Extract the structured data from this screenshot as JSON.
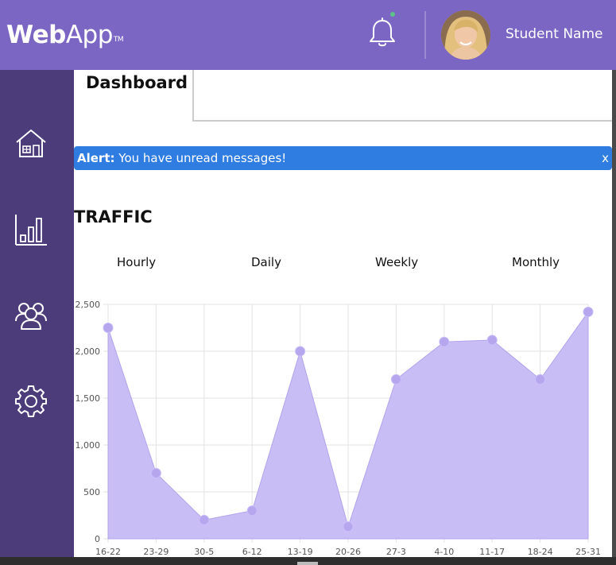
{
  "header": {
    "logo_bold": "Web",
    "logo_light": "App",
    "logo_tm": "TM",
    "user_name": "Student Name",
    "notification_dot_color": "#5dc38a"
  },
  "sidebar": {
    "items": [
      {
        "icon": "home-icon"
      },
      {
        "icon": "bar-chart-icon"
      },
      {
        "icon": "users-icon"
      },
      {
        "icon": "gear-icon"
      }
    ]
  },
  "main": {
    "page_title": "Dashboard",
    "alert": {
      "label": "Alert:",
      "message": "You have unread messages!",
      "close": "x",
      "color": "#2f7de1"
    },
    "traffic": {
      "title": "TRAFFIC",
      "tabs": [
        "Hourly",
        "Daily",
        "Weekly",
        "Monthly"
      ]
    }
  },
  "colors": {
    "header": "#7b67c3",
    "sidebar": "#4d3c7a",
    "chart_fill": "#c8bdf5",
    "chart_point": "#b5a6ee"
  },
  "chart_data": {
    "type": "area",
    "categories": [
      "16-22",
      "23-29",
      "30-5",
      "6-12",
      "13-19",
      "20-26",
      "27-3",
      "4-10",
      "11-17",
      "18-24",
      "25-31"
    ],
    "values": [
      2250,
      700,
      200,
      300,
      2000,
      130,
      1700,
      2100,
      2120,
      1700,
      2420
    ],
    "ylim": [
      0,
      2500
    ],
    "yticks": [
      0,
      500,
      1000,
      1500,
      2000,
      2500
    ],
    "ytick_labels": [
      "0",
      "500",
      "1,000",
      "1,500",
      "2,000",
      "2,500"
    ],
    "grid": true
  }
}
